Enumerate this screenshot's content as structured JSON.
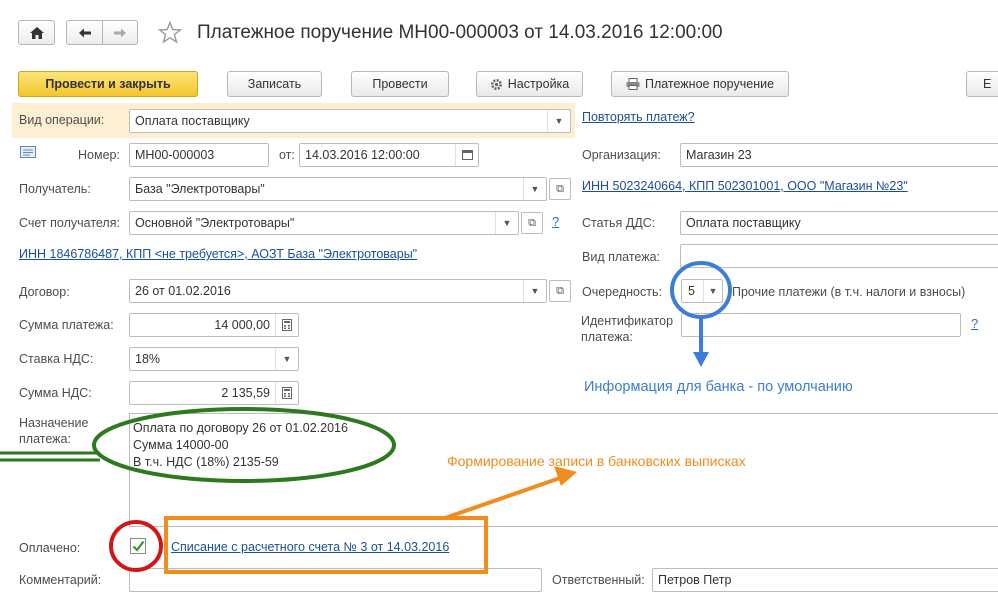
{
  "window": {
    "title": "Платежное поручение МН00-000003 от 14.03.2016 12:00:00"
  },
  "toolbar": {
    "post_close": "Провести и закрыть",
    "save": "Записать",
    "post": "Провести",
    "settings": "Настройка",
    "payment_order": "Платежное поручение",
    "more": "Е"
  },
  "form": {
    "operation_label": "Вид операции:",
    "operation_value": "Оплата поставщику",
    "repeat_link": "Повторять платеж?",
    "number_label": "Номер:",
    "number_value": "МН00-000003",
    "date_label": "от:",
    "date_value": "14.03.2016 12:00:00",
    "org_label": "Организация:",
    "org_value": "Магазин 23",
    "recipient_label": "Получатель:",
    "recipient_value": "База \"Электротовары\"",
    "org_inn_link": "ИНН 5023240664, КПП 502301001, ООО \"Магазин №23\"",
    "account_label": "Счет получателя:",
    "account_value": "Основной \"Электротовары\"",
    "q_mark": "?",
    "dds_label": "Статья ДДС:",
    "dds_value": "Оплата поставщику",
    "recipient_inn_link": "ИНН 1846786487, КПП <не требуется>, АОЗТ База \"Электротовары\"",
    "payment_kind_label": "Вид платежа:",
    "payment_kind_value": "",
    "contract_label": "Договор:",
    "contract_value": "26 от 01.02.2016",
    "priority_label": "Очередность:",
    "priority_value": "5",
    "priority_desc": "Прочие платежи (в т.ч. налоги и взносы)",
    "amount_label": "Сумма платежа:",
    "amount_value": "14 000,00",
    "id_label_1": "Идентификатор",
    "id_label_2": "платежа:",
    "id_value": "",
    "vat_rate_label": "Ставка НДС:",
    "vat_rate_value": "18%",
    "vat_sum_label": "Сумма НДС:",
    "vat_sum_value": "2 135,59",
    "purpose_label_1": "Назначение",
    "purpose_label_2": "платежа:",
    "purpose_lines": [
      "Оплата по договору 26 от 01.02.2016",
      "Сумма 14000-00",
      "В т.ч. НДС  (18%) 2135-59"
    ],
    "paid_label": "Оплачено:",
    "writeoff_link": "Списание с расчетного счета № 3 от 14.03.2016",
    "comment_label": "Комментарий:",
    "comment_value": "",
    "responsible_label": "Ответственный:",
    "responsible_value": "Петров Петр"
  },
  "annotations": {
    "bank_info": "Информация для банка - по умолчанию",
    "bank_records": "Формирование записи в банковских выписках"
  },
  "colors": {
    "accent_yellow": "#f8d544",
    "highlight_row": "#fdf0d2",
    "link_blue": "#1a4f9c",
    "annot_blue": "#3b7dd8",
    "annot_orange": "#f28c1f",
    "annot_green": "#2c7a1d",
    "annot_red": "#d11616"
  },
  "icons": {
    "home": "home-icon",
    "back": "arrow-left-icon",
    "forward": "arrow-right-icon",
    "star": "star-icon",
    "gear": "gear-icon",
    "printer": "printer-icon",
    "calendar": "calendar-icon",
    "calculator": "calculator-icon",
    "open": "open-icon",
    "checkmark": "checkmark-icon"
  }
}
